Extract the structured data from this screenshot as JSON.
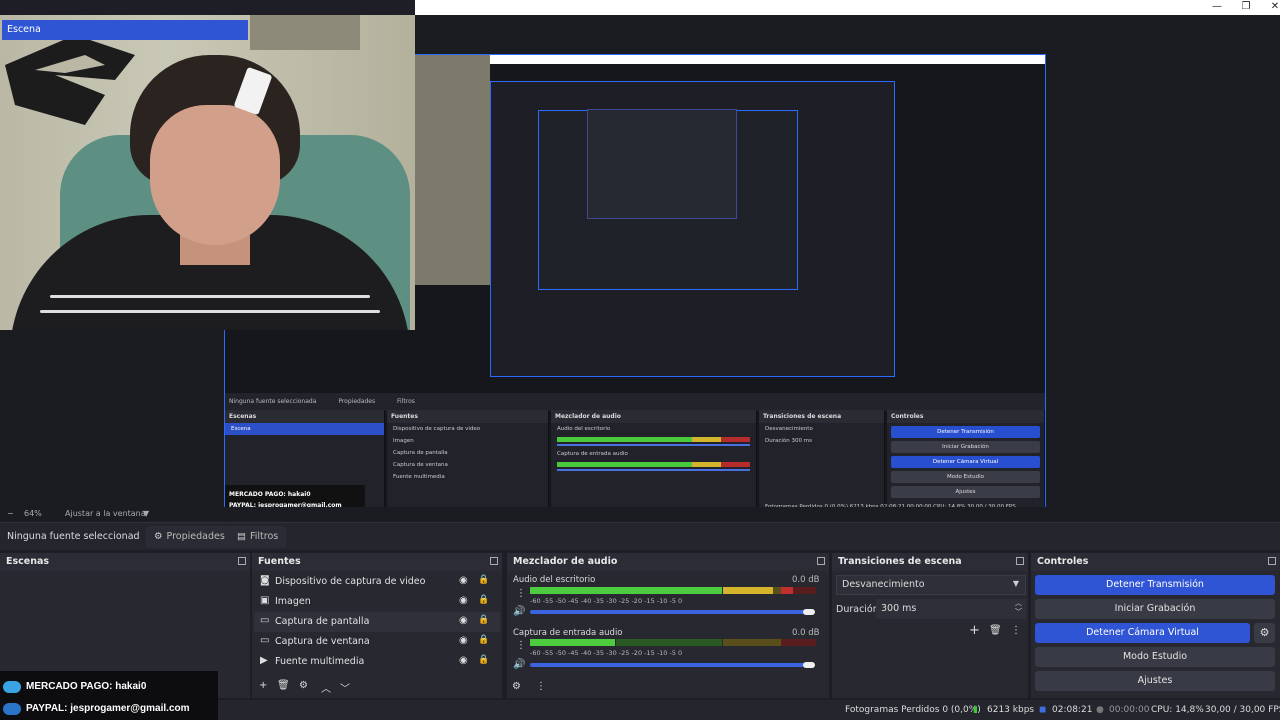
{
  "window": {
    "minimize_glyph": "—",
    "maximize_glyph": "❐",
    "close_glyph": "✕"
  },
  "nested": {
    "panel_no_source": "Ninguna fuente seleccionada",
    "panel_properties": "Propiedades",
    "panel_filters": "Filtros",
    "zoom": "64%",
    "fit": "Ajustar a la ventana",
    "docks": {
      "scenes": "Escenas",
      "sources": "Fuentes",
      "mixer": "Mezclador de audio",
      "transitions": "Transiciones de escena",
      "controls": "Controles"
    },
    "scene": "Escena",
    "sources": [
      "Dispositivo de captura de video",
      "Imagen",
      "Captura de pantalla",
      "Captura de ventana",
      "Fuente multimedia"
    ],
    "mixer_tracks": [
      "Audio del escritorio",
      "Captura de entrada audio"
    ],
    "transition": "Desvanecimiento",
    "duration_label": "Duración",
    "duration_value": "300 ms",
    "controls": [
      "Detener Transmisión",
      "Iniciar Grabación",
      "Detener Cámara Virtual",
      "Modo Estudio",
      "Ajustes"
    ],
    "status": "Fotogramas Perdidos 0 (0,0%)   6213 kbps   02:08:21   00:00:00   CPU: 14,8%   30,00 / 30,00 FPS",
    "overlay_mp": "MERCADO PAGO: hakai0",
    "overlay_pp": "PAYPAL: jesprogamer@gmail.com"
  },
  "zoombar": {
    "minus": "−",
    "zoom": "64%",
    "fit": "Ajustar a la ventana",
    "arrow": "▼"
  },
  "props": {
    "no_source": "Ninguna fuente seleccionad",
    "properties": "Propiedades",
    "filters": "Filtros"
  },
  "docks": {
    "scenes_title": "Escenas",
    "sources_title": "Fuentes",
    "mixer_title": "Mezclador de audio",
    "transitions_title": "Transiciones de escena",
    "controls_title": "Controles"
  },
  "scenes": {
    "items": [
      "Escena"
    ]
  },
  "sources": {
    "items": [
      {
        "label": "Dispositivo de captura de video",
        "icon": "camera-icon",
        "glyph": "◙"
      },
      {
        "label": "Imagen",
        "icon": "image-icon",
        "glyph": "▣"
      },
      {
        "label": "Captura de pantalla",
        "icon": "monitor-icon",
        "glyph": "▭"
      },
      {
        "label": "Captura de ventana",
        "icon": "window-icon",
        "glyph": "▭"
      },
      {
        "label": "Fuente multimedia",
        "icon": "play-icon",
        "glyph": "▶"
      }
    ],
    "toolbar": {
      "add": "+",
      "remove": "🗑",
      "settings": "⚙",
      "up": "︿",
      "down": "﹀"
    }
  },
  "mixer": {
    "tracks": [
      {
        "name": "Audio del escritorio",
        "db": "0.0 dB"
      },
      {
        "name": "Captura de entrada audio",
        "db": "0.0 dB"
      }
    ],
    "ticks": "-60    -55    -50    -45    -40    -35    -30    -25    -20    -15    -10    -5     0",
    "menu_glyph": "⋮",
    "speaker_glyph": "🔊",
    "gear_glyph": "⚙"
  },
  "transitions": {
    "selected": "Desvanecimiento",
    "duration_label": "Duración",
    "duration_value": "300 ms",
    "add": "+",
    "remove": "🗑",
    "menu": "⋮"
  },
  "controls": {
    "stop_stream": "Detener Transmisión",
    "start_recording": "Iniciar Grabación",
    "stop_virtual_cam": "Detener Cámara Virtual",
    "studio_mode": "Modo Estudio",
    "settings": "Ajustes",
    "gear": "⚙"
  },
  "status": {
    "dropped": "Fotogramas Perdidos 0 (0,0%)",
    "kbps": "6213 kbps",
    "stream_time": "02:08:21",
    "rec_time": "00:00:00",
    "cpu": "CPU: 14,8%",
    "fps": "30,00 / 30,00 FPS"
  },
  "overlay": {
    "mercadopago": "MERCADO PAGO: hakai0",
    "paypal": "PAYPAL: jesprogamer@gmail.com"
  },
  "colors": {
    "accent": "#2f55d4",
    "bg": "#1e1f26",
    "dock": "#272830"
  }
}
